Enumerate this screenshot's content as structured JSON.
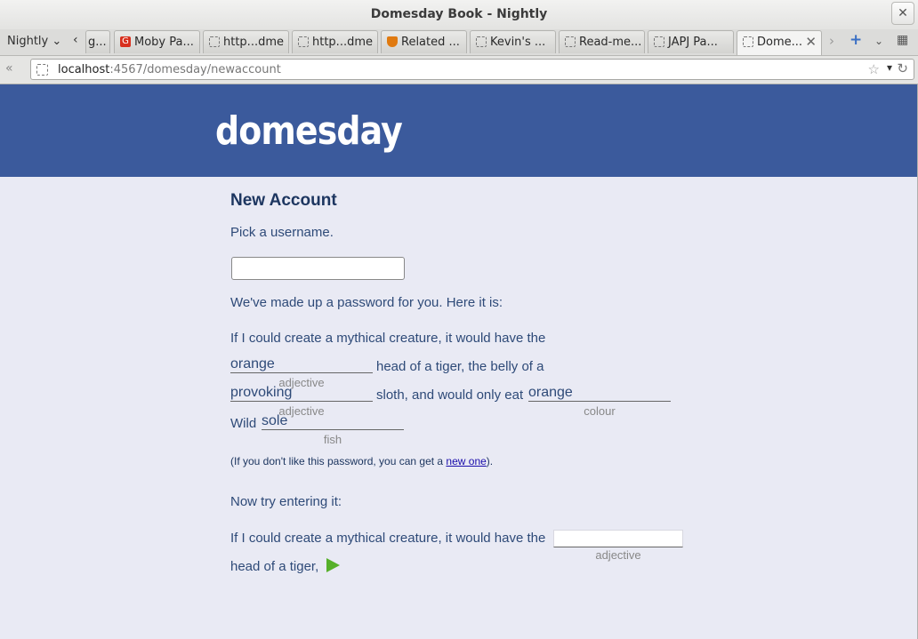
{
  "window": {
    "title": "Domesday Book - Nightly",
    "close_glyph": "✕"
  },
  "tabbar": {
    "menu_label": "Nightly",
    "partial_tab": "g...",
    "tabs": [
      {
        "label": "Moby Pa...",
        "icon": "moby-icon"
      },
      {
        "label": "http...dme",
        "icon": "page-icon"
      },
      {
        "label": "http...dme",
        "icon": "page-icon"
      },
      {
        "label": "Related ...",
        "icon": "shield-icon"
      },
      {
        "label": "Kevin's ...",
        "icon": "page-icon"
      },
      {
        "label": "Read-me...",
        "icon": "page-icon"
      },
      {
        "label": "JAPJ Pa...",
        "icon": "page-icon"
      },
      {
        "label": "Dome...",
        "icon": "page-icon",
        "active": true
      }
    ],
    "close_glyph": "✕"
  },
  "navbar": {
    "url_host": "localhost",
    "url_rest": ":4567/domesday/newaccount"
  },
  "site": {
    "logo": "domesday"
  },
  "page": {
    "heading": "New Account",
    "pick_username": "Pick a username.",
    "username_value": "",
    "made_password": "We've made up a password for you. Here it is:",
    "sentence_1": "If I could create a mythical creature, it would have the",
    "word_1": "orange",
    "hint_1": "adjective",
    "text_2": "head of a tiger, the belly of a",
    "word_2": "provoking",
    "hint_2": "adjective",
    "text_3": "sloth, and would only eat",
    "word_3": "orange",
    "hint_3": "colour",
    "text_4": "Wild",
    "word_4": "sole",
    "hint_4": "fish",
    "dislike_pre": "(If you don't like this password, you can get a ",
    "new_one_link": "new one",
    "dislike_post": ").",
    "try_entering": "Now try entering it:",
    "try_sentence": "If I could create a mythical creature, it would have the",
    "try_hint": "adjective",
    "try_tail": "head of a tiger,"
  },
  "colors": {
    "header_bg": "#3b5a9c",
    "page_bg": "#e9eaf4",
    "text": "#2e4a78",
    "go_arrow": "#56b02a"
  }
}
